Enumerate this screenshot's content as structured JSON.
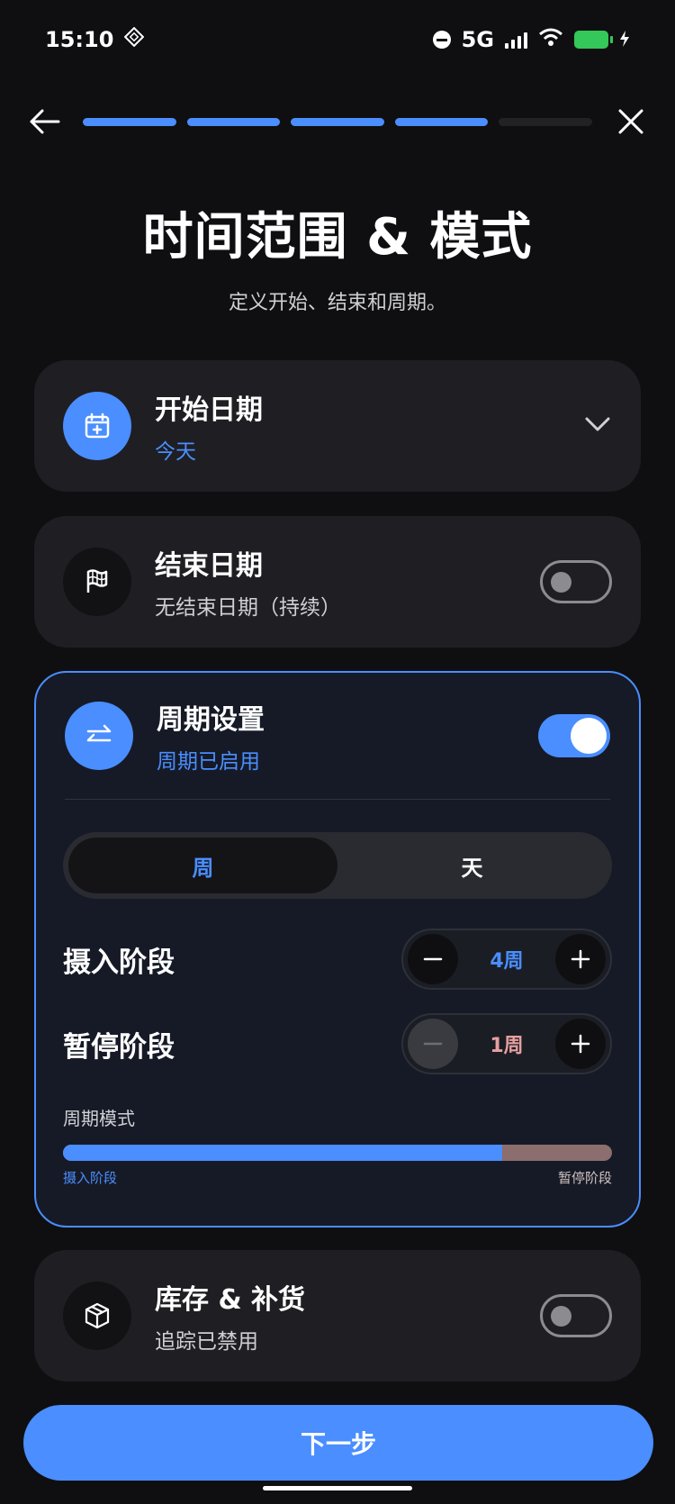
{
  "status": {
    "time": "15:10",
    "network": "5G"
  },
  "progress": {
    "total_steps": 5,
    "completed_steps": 4
  },
  "header": {
    "title": "时间范围 & 模式",
    "subtitle": "定义开始、结束和周期。"
  },
  "start_date": {
    "label": "开始日期",
    "value": "今天"
  },
  "end_date": {
    "label": "结束日期",
    "value": "无结束日期（持续）",
    "enabled": false
  },
  "cycle": {
    "label": "周期设置",
    "status": "周期已启用",
    "enabled": true,
    "units": [
      {
        "label": "周",
        "active": true
      },
      {
        "label": "天",
        "active": false
      }
    ],
    "intake": {
      "label": "摄入阶段",
      "value": "4周",
      "count": 4
    },
    "pause": {
      "label": "暂停阶段",
      "value": "1周",
      "count": 1
    },
    "mode_label": "周期模式",
    "mode_legend_left": "摄入阶段",
    "mode_legend_right": "暂停阶段"
  },
  "inventory": {
    "label": "库存 & 补货",
    "status": "追踪已禁用",
    "enabled": false
  },
  "next_button": {
    "label": "下一步"
  },
  "colors": {
    "accent": "#4a8eff",
    "pause_phase": "#8c6e6e",
    "background": "#0f0f11",
    "card": "#1f1e23",
    "toggle_off": "#8b8b90",
    "battery": "#34c759"
  }
}
